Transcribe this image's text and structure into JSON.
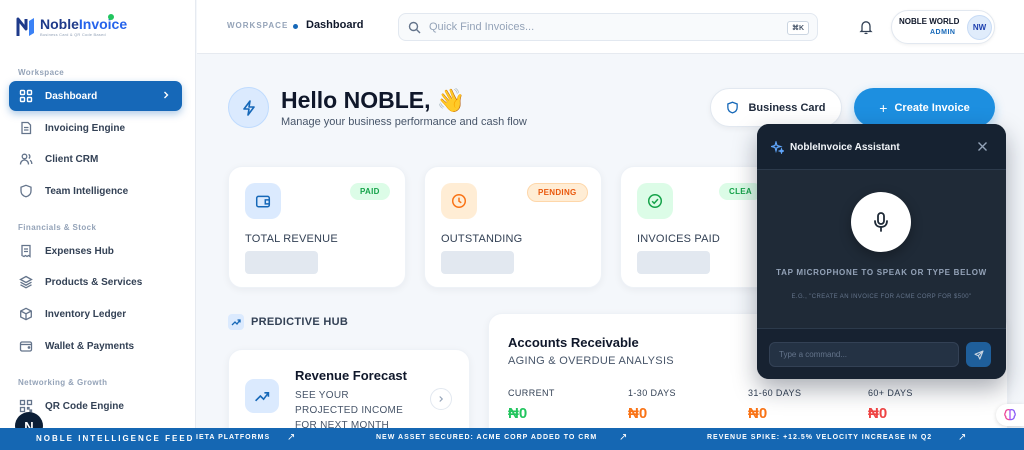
{
  "app": {
    "logo_name_part1": "Noble",
    "logo_name_part2": "Invoice",
    "logo_tagline": "Business Card & QR Code Based",
    "n_badge": "N"
  },
  "sidebar": {
    "sections": [
      {
        "label": "Workspace"
      },
      {
        "label": "Financials & Stock"
      },
      {
        "label": "Networking & Growth"
      }
    ],
    "items": [
      {
        "label": "Dashboard",
        "icon": "grid-icon",
        "active": true
      },
      {
        "label": "Invoicing Engine",
        "icon": "document-icon"
      },
      {
        "label": "Client CRM",
        "icon": "users-icon"
      },
      {
        "label": "Team Intelligence",
        "icon": "shield-icon"
      },
      {
        "label": "Expenses Hub",
        "icon": "receipt-icon"
      },
      {
        "label": "Products & Services",
        "icon": "layers-icon"
      },
      {
        "label": "Inventory Ledger",
        "icon": "box-icon"
      },
      {
        "label": "Wallet & Payments",
        "icon": "wallet-icon"
      },
      {
        "label": "QR Code Engine",
        "icon": "qr-icon"
      }
    ]
  },
  "topbar": {
    "workspace_label": "WORKSPACE",
    "page": "Dashboard",
    "search_placeholder": "Quick Find Invoices...",
    "shortcut": "⌘K",
    "user_name": "NOBLE WORLD",
    "user_role": "ADMIN",
    "avatar_initials": "NW"
  },
  "hero": {
    "greeting": "Hello NOBLE, 👋",
    "subtitle": "Manage your business performance and cash flow",
    "business_card_label": "Business Card",
    "create_invoice_label": "Create Invoice"
  },
  "stats": [
    {
      "label": "TOTAL REVENUE",
      "status": "PAID",
      "icon": "wallet-icon",
      "color": "#22c55e"
    },
    {
      "label": "OUTSTANDING",
      "status": "PENDING",
      "icon": "clock-icon",
      "color": "#f97316"
    },
    {
      "label": "INVOICES PAID",
      "status": "CLEA",
      "icon": "check-circle-icon",
      "color": "#22c55e"
    }
  ],
  "predictive": {
    "label": "PREDICTIVE HUB",
    "forecast_title": "Revenue Forecast",
    "forecast_desc": "SEE YOUR PROJECTED INCOME FOR NEXT MONTH"
  },
  "receivable": {
    "title": "Accounts Receivable",
    "subtitle": "AGING & OVERDUE ANALYSIS",
    "columns": [
      {
        "label": "CURRENT",
        "value": "₦0",
        "color": "#22c55e"
      },
      {
        "label": "1-30 DAYS",
        "value": "₦0",
        "color": "#f97316"
      },
      {
        "label": "31-60 DAYS",
        "value": "₦0",
        "color": "#f97316"
      },
      {
        "label": "60+ DAYS",
        "value": "₦0",
        "color": "#ef4444"
      }
    ]
  },
  "assistant": {
    "title": "NobleInvoice Assistant",
    "prompt": "TAP MICROPHONE TO SPEAK OR TYPE BELOW",
    "example": "E.G., \"CREATE AN INVOICE FOR ACME CORP FOR $500\"",
    "input_placeholder": "Type a command..."
  },
  "ticker": {
    "label": "NOBLE INTELLIGENCE FEED",
    "items": [
      "IETA PLATFORMS",
      "NEW ASSET SECURED: ACME CORP ADDED TO CRM",
      "REVENUE SPIKE: +12.5% VELOCITY INCREASE IN Q2"
    ]
  },
  "colors": {
    "primary": "#1668b8",
    "accent": "#1d8fe0",
    "ticker": "#1567b3",
    "assistant_bg": "#1f2a37"
  }
}
